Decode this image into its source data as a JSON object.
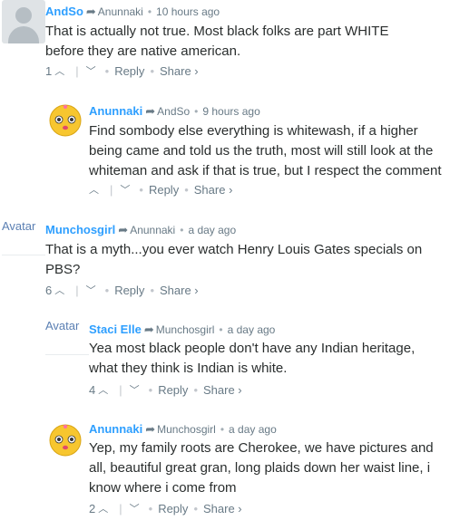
{
  "comments": [
    {
      "author": "AndSo",
      "reply_to": "Anunnaki",
      "time": "10 hours ago",
      "text": "That is actually not true. Most black folks are part WHITE before they are native american.",
      "votes": "1",
      "reply_label": "Reply",
      "share_label": "Share ›",
      "avatar": "generic-avatar"
    },
    {
      "author": "Anunnaki",
      "reply_to": "AndSo",
      "time": "9 hours ago",
      "text": "Find sombody else everything is whitewash, if a higher being came and told us the truth, most will still look at the whiteman and ask if that is true, but I respect the comment",
      "votes": "",
      "reply_label": "Reply",
      "share_label": "Share ›",
      "avatar": "emoji-avatar"
    },
    {
      "author": "Munchosgirl",
      "reply_to": "Anunnaki",
      "time": "a day ago",
      "text": "That is a myth...you ever watch Henry Louis Gates specials on PBS?",
      "votes": "6",
      "reply_label": "Reply",
      "share_label": "Share ›",
      "avatar_alt": "Avatar"
    },
    {
      "author": "Staci Elle",
      "reply_to": "Munchosgirl",
      "time": "a day ago",
      "text": "Yea most black people don't have any Indian heritage, what they think is Indian is white.",
      "votes": "4",
      "reply_label": "Reply",
      "share_label": "Share ›",
      "avatar_alt": "Avatar"
    },
    {
      "author": "Anunnaki",
      "reply_to": "Munchosgirl",
      "time": "a day ago",
      "text": "Yep, my family roots are Cherokee, we have pictures and all, beautiful great gran, long plaids down her waist line, i know where i come from",
      "votes": "2",
      "reply_label": "Reply",
      "share_label": "Share ›",
      "avatar": "emoji-avatar"
    }
  ],
  "colors": {
    "author": "#2e9fff",
    "meta": "#687a86",
    "text": "#2a2e2e"
  }
}
